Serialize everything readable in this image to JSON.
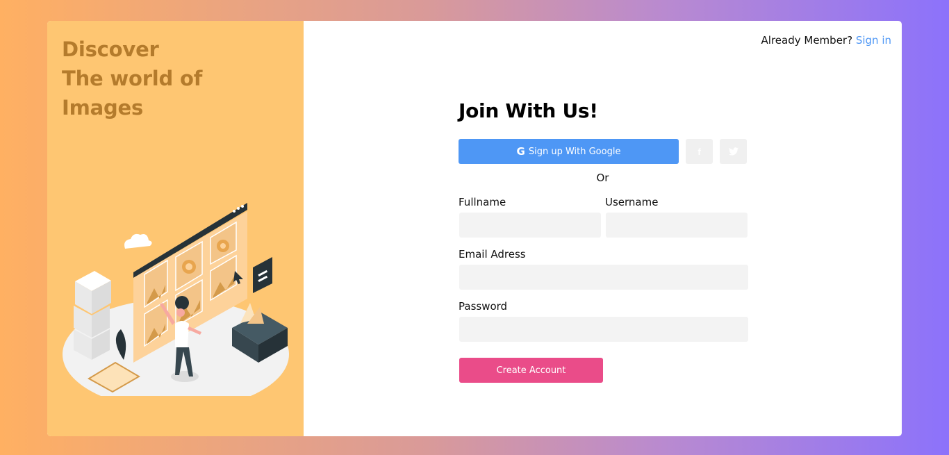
{
  "hero": {
    "line1": "Discover",
    "line2": "The world of",
    "line3": "Images"
  },
  "header": {
    "member_text": "Already Member?",
    "signin_link": "Sign in"
  },
  "form": {
    "title": "Join With Us!",
    "google_label": "Sign up With Google",
    "google_glyph": "G",
    "facebook_glyph": "f",
    "twitter_icon": "twitter-icon",
    "or_text": "Or",
    "fullname_label": "Fullname",
    "username_label": "Username",
    "email_label": "Email Adress",
    "password_label": "Password",
    "create_label": "Create Account"
  },
  "colors": {
    "accent_blue": "#4e97f5",
    "create_pink": "#ea4c89",
    "left_panel": "#fec672",
    "hero_text": "#b47b2c"
  }
}
